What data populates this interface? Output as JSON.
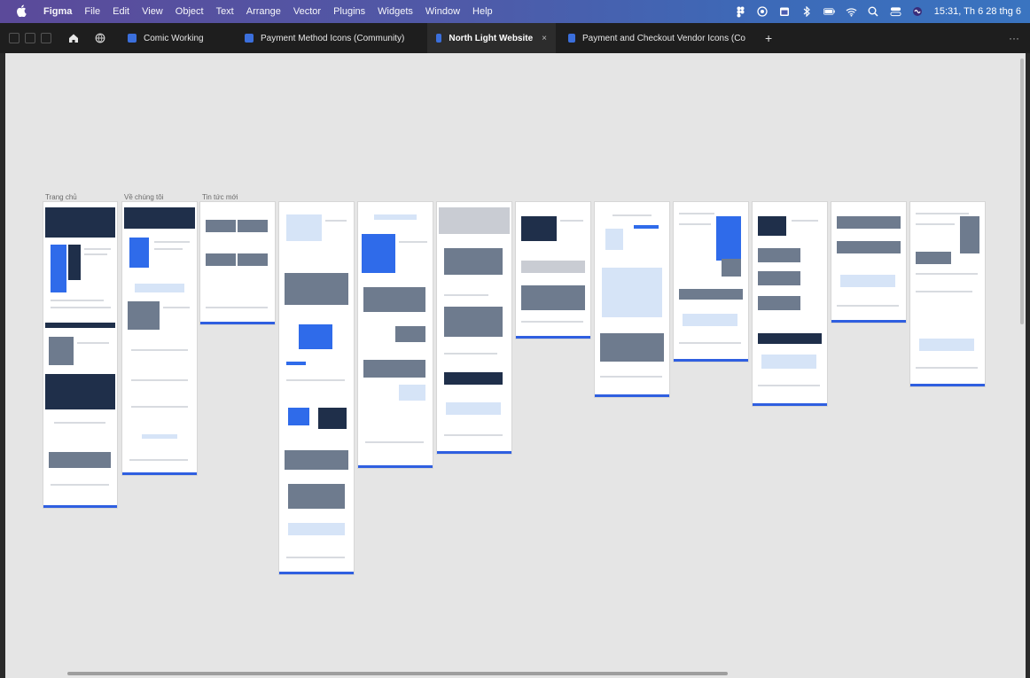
{
  "menubar": {
    "items": [
      "Figma",
      "File",
      "Edit",
      "View",
      "Object",
      "Text",
      "Arrange",
      "Vector",
      "Plugins",
      "Widgets",
      "Window",
      "Help"
    ],
    "clock": "15:31, Th 6 28 thg 6",
    "status_icons": [
      "figma-icon",
      "record-icon",
      "calendar-icon",
      "bluetooth-icon",
      "battery-icon",
      "wifi-icon",
      "search-icon",
      "control-center-icon",
      "siri-icon"
    ]
  },
  "tabs": {
    "items": [
      {
        "label": "Comic Working",
        "active": false
      },
      {
        "label": "Payment Method Icons (Community)",
        "active": false
      },
      {
        "label": "North Light Website",
        "active": true
      },
      {
        "label": "Payment and Checkout Vendor Icons (Co",
        "active": false
      }
    ],
    "close_label": "×",
    "add_label": "+",
    "more_label": "···"
  },
  "canvas": {
    "frame_labels": [
      "Trang chủ",
      "Về chúng tôi",
      "Tin tức mới"
    ]
  },
  "colors": {
    "canvas_bg": "#e5e5e5",
    "accent": "#2f5fe0",
    "tabbar_bg": "#1e1e1e"
  }
}
